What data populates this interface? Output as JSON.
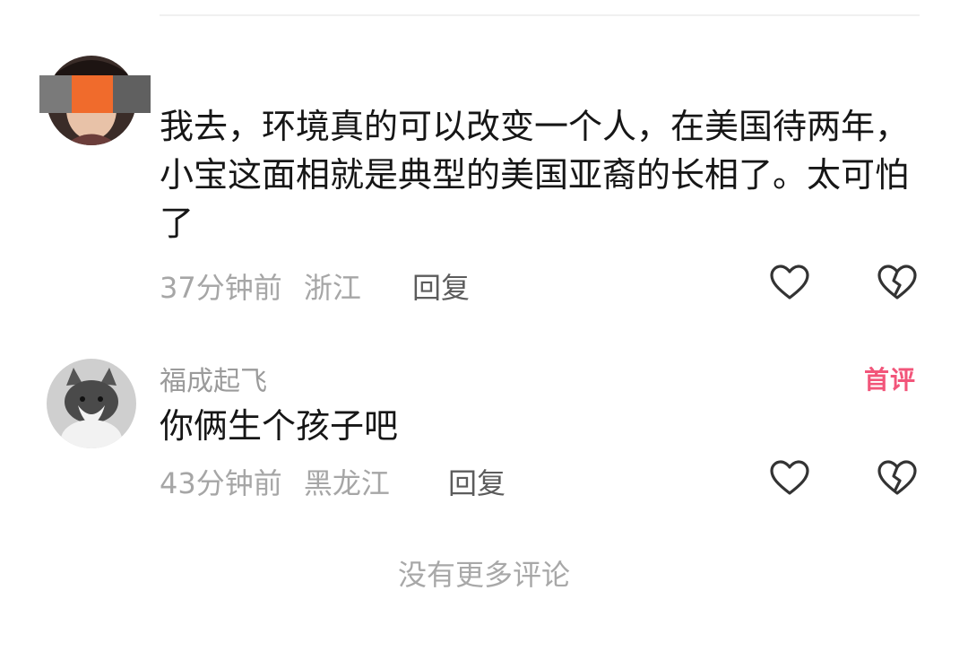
{
  "comments": [
    {
      "username": "",
      "text": "我去，环境真的可以改变一个人，在美国待两年，小宝这面相就是典型的美国亚裔的长相了。太可怕了",
      "time": "37分钟前",
      "location": "浙江",
      "reply_label": "回复",
      "like_icon": "heart-outline-icon",
      "dislike_icon": "broken-heart-icon"
    },
    {
      "username": "福成起飞",
      "badge": "首评",
      "text": "你俩生个孩子吧",
      "time": "43分钟前",
      "location": "黑龙江",
      "reply_label": "回复",
      "like_icon": "heart-outline-icon",
      "dislike_icon": "broken-heart-icon"
    }
  ],
  "footer": {
    "no_more_text": "没有更多评论"
  },
  "colors": {
    "text": "#161616",
    "meta": "#a6a6a6",
    "reply": "#5c5c5c",
    "badge": "#f2557a"
  }
}
